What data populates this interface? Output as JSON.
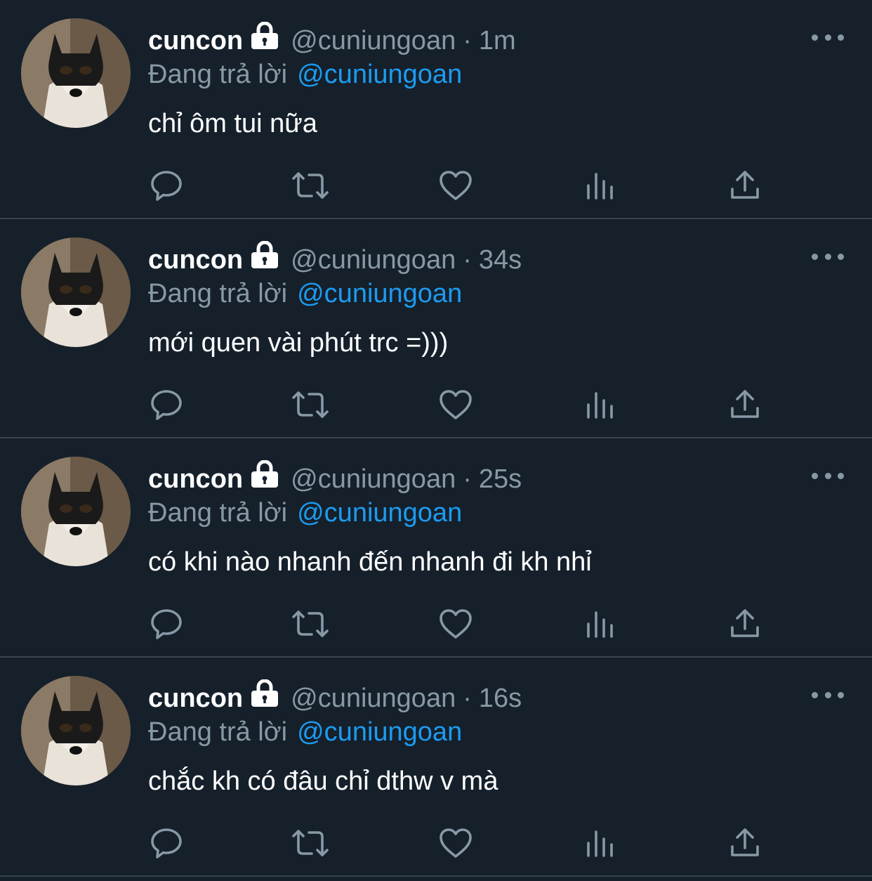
{
  "tweets": [
    {
      "display_name": "cuncon",
      "handle": "@cuniungoan",
      "separator": "·",
      "time": "1m",
      "reply_label": "Đang trả lời",
      "reply_to": "@cuniungoan",
      "text": "chỉ ôm tui nữa"
    },
    {
      "display_name": "cuncon",
      "handle": "@cuniungoan",
      "separator": "·",
      "time": "34s",
      "reply_label": "Đang trả lời",
      "reply_to": "@cuniungoan",
      "text": "mới quen vài phút trc =)))"
    },
    {
      "display_name": "cuncon",
      "handle": "@cuniungoan",
      "separator": "·",
      "time": "25s",
      "reply_label": "Đang trả lời",
      "reply_to": "@cuniungoan",
      "text": "có khi nào nhanh đến nhanh đi kh nhỉ"
    },
    {
      "display_name": "cuncon",
      "handle": "@cuniungoan",
      "separator": "·",
      "time": "16s",
      "reply_label": "Đang trả lời",
      "reply_to": "@cuniungoan",
      "text": "chắc kh có đâu chỉ dthw v mà"
    }
  ],
  "icons": {
    "lock": "lock-icon",
    "more": "more-options-icon",
    "reply": "reply-icon",
    "retweet": "retweet-icon",
    "like": "like-icon",
    "analytics": "analytics-icon",
    "share": "share-icon"
  },
  "colors": {
    "background": "#15202b",
    "divider": "#38444d",
    "secondary_text": "#8899a6",
    "link": "#1d9bf0",
    "primary_text": "#ffffff"
  }
}
